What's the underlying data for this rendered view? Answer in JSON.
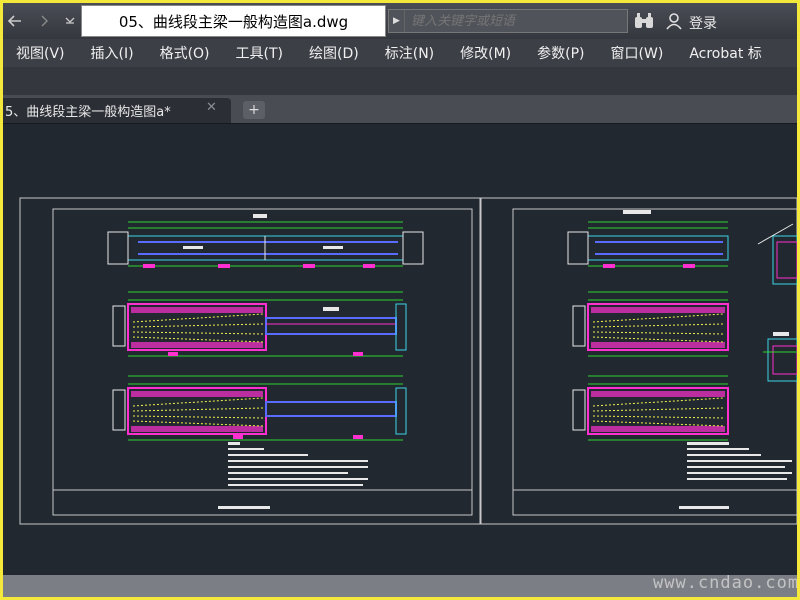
{
  "titlebar": {
    "document_title": "05、曲线段主梁一般构造图a.dwg",
    "search_placeholder": "键入关键字或短语",
    "login_label": "登录"
  },
  "menu": {
    "items": [
      "视图(V)",
      "插入(I)",
      "格式(O)",
      "工具(T)",
      "绘图(D)",
      "标注(N)",
      "修改(M)",
      "参数(P)",
      "窗口(W)",
      "Acrobat 标"
    ]
  },
  "tabs": {
    "active_label": "5、曲线段主梁一般构造图a*",
    "close_glyph": "✕",
    "add_glyph": "+"
  },
  "watermark": "www.cndao.com",
  "colors": {
    "canvas_bg": "#212830",
    "cad_white": "#e8e8e8",
    "cad_green": "#2fd52f",
    "cad_magenta": "#ff2fd0",
    "cad_cyan": "#3ad4e8",
    "cad_yellow": "#f2f24a",
    "cad_blue": "#5a6cff",
    "frame_yellow": "#f4e83a"
  },
  "icons": {
    "back": "back-arrow-icon",
    "search": "binoculars-icon",
    "user": "user-icon"
  }
}
